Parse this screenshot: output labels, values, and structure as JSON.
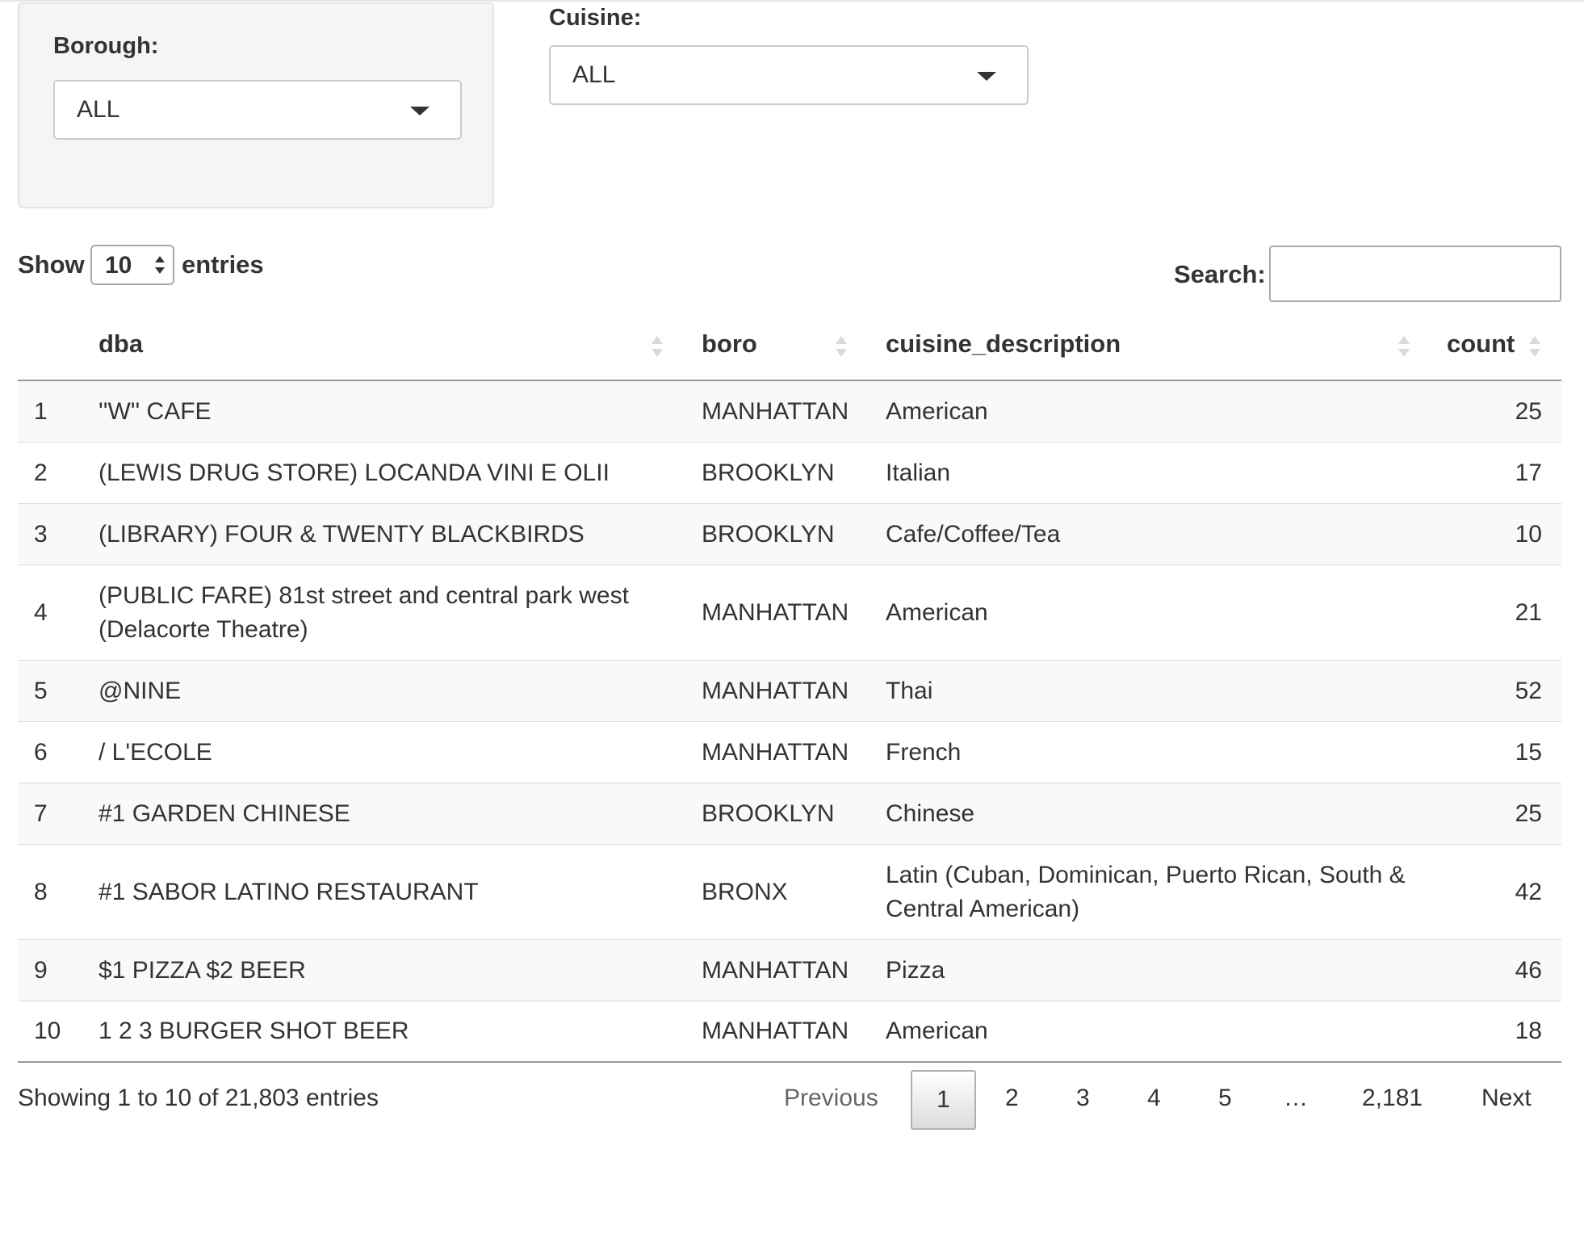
{
  "filters": {
    "borough": {
      "label": "Borough:",
      "value": "ALL"
    },
    "cuisine": {
      "label": "Cuisine:",
      "value": "ALL"
    }
  },
  "table_controls": {
    "show_label": "Show",
    "length_value": "10",
    "entries_label": "entries",
    "search_label": "Search:",
    "search_value": ""
  },
  "table": {
    "columns": [
      "",
      "dba",
      "boro",
      "cuisine_description",
      "count"
    ],
    "rows": [
      {
        "idx": "1",
        "dba": "''W'' CAFE",
        "boro": "MANHATTAN",
        "cuisine": "American",
        "count": "25"
      },
      {
        "idx": "2",
        "dba": "(LEWIS DRUG STORE) LOCANDA VINI E OLII",
        "boro": "BROOKLYN",
        "cuisine": "Italian",
        "count": "17"
      },
      {
        "idx": "3",
        "dba": "(LIBRARY) FOUR & TWENTY BLACKBIRDS",
        "boro": "BROOKLYN",
        "cuisine": "Cafe/Coffee/Tea",
        "count": "10"
      },
      {
        "idx": "4",
        "dba": "(PUBLIC FARE) 81st street and central park west (Delacorte Theatre)",
        "boro": "MANHATTAN",
        "cuisine": "American",
        "count": "21"
      },
      {
        "idx": "5",
        "dba": "@NINE",
        "boro": "MANHATTAN",
        "cuisine": "Thai",
        "count": "52"
      },
      {
        "idx": "6",
        "dba": "/ L'ECOLE",
        "boro": "MANHATTAN",
        "cuisine": "French",
        "count": "15"
      },
      {
        "idx": "7",
        "dba": "#1 GARDEN CHINESE",
        "boro": "BROOKLYN",
        "cuisine": "Chinese",
        "count": "25"
      },
      {
        "idx": "8",
        "dba": "#1 SABOR LATINO RESTAURANT",
        "boro": "BRONX",
        "cuisine": "Latin (Cuban, Dominican, Puerto Rican, South & Central American)",
        "count": "42"
      },
      {
        "idx": "9",
        "dba": "$1 PIZZA $2 BEER",
        "boro": "MANHATTAN",
        "cuisine": "Pizza",
        "count": "46"
      },
      {
        "idx": "10",
        "dba": "1 2 3 BURGER SHOT BEER",
        "boro": "MANHATTAN",
        "cuisine": "American",
        "count": "18"
      }
    ]
  },
  "footer": {
    "info": "Showing 1 to 10 of 21,803 entries",
    "pagination": {
      "previous": "Previous",
      "current": "1",
      "pages": [
        "2",
        "3",
        "4",
        "5"
      ],
      "ellipsis": "…",
      "last": "2,181",
      "next": "Next"
    }
  },
  "colors": {
    "well_bg": "#f5f5f5",
    "row_stripe": "#f9f9f9",
    "header_rule": "#999999",
    "row_rule": "#dddddd"
  }
}
